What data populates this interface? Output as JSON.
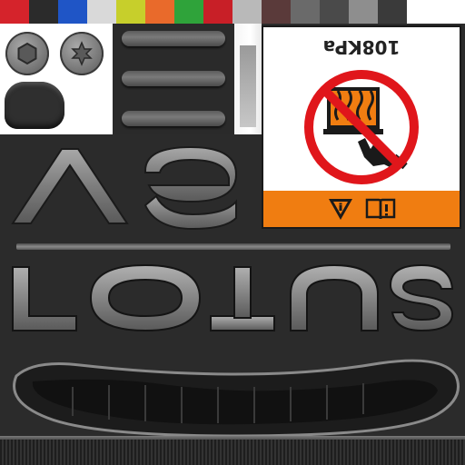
{
  "swatches": [
    "#d5232b",
    "#2b2b2b",
    "#1f55c6",
    "#d9d9d9",
    "#c7cf2b",
    "#e96a2b",
    "#2fa33a",
    "#c81f27",
    "#b9b9b9",
    "#5a3a3a",
    "#6a6a6a",
    "#4a4a4a",
    "#8e8e8e",
    "#3a3a3a",
    "#ffffff",
    "#ffffff"
  ],
  "warning_label": {
    "pressure_text": "108KPa",
    "band_color": "#f07d11",
    "prohibition_color": "#e0161b"
  },
  "icons": [
    "hex-bolt-icon",
    "torx-bolt-icon",
    "no-hand-icon",
    "info-triangle-icon",
    "manual-book-icon"
  ],
  "lettering": {
    "top_word": "VE",
    "main_word": "LOTUS"
  }
}
